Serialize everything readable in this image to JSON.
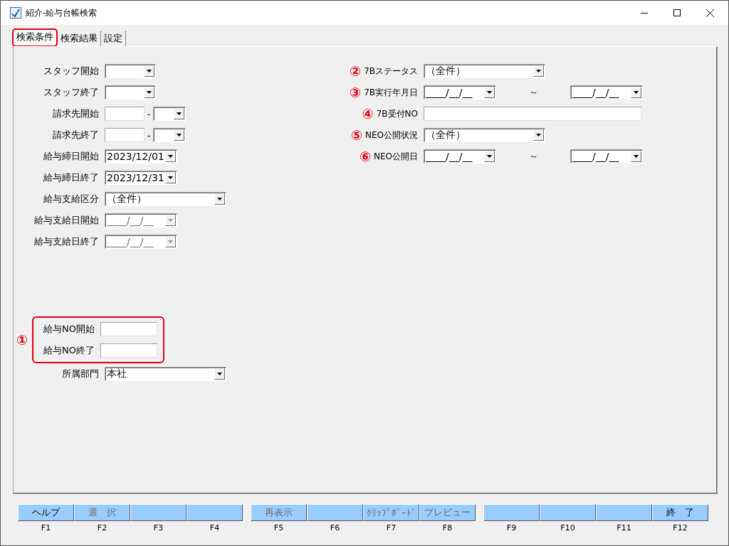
{
  "window": {
    "title": "紹介-給与台帳検索"
  },
  "tabs": [
    {
      "label": "検索条件",
      "selected": true,
      "highlighted": true
    },
    {
      "label": "検索結果",
      "selected": false,
      "highlighted": false
    },
    {
      "label": "設定",
      "selected": false,
      "highlighted": false
    }
  ],
  "left_fields": [
    {
      "label": "スタッフ開始",
      "kind": "picker",
      "disabled": false
    },
    {
      "label": "スタッフ終了",
      "kind": "picker",
      "disabled": false
    },
    {
      "label": "請求先開始",
      "kind": "split",
      "separator": "-"
    },
    {
      "label": "請求先終了",
      "kind": "split",
      "separator": "-"
    },
    {
      "label": "給与締日開始",
      "kind": "date",
      "value": "2023/12/01",
      "disabled": false
    },
    {
      "label": "給与締日終了",
      "kind": "date",
      "value": "2023/12/31",
      "disabled": false
    },
    {
      "label": "給与支給区分",
      "kind": "select",
      "value": "（全件）",
      "disabled": false
    },
    {
      "label": "給与支給日開始",
      "kind": "date",
      "value": "____/__/__",
      "disabled": true
    },
    {
      "label": "給与支給日終了",
      "kind": "date",
      "value": "____/__/__",
      "disabled": true
    }
  ],
  "number_range": {
    "marker": "①",
    "highlighted": true,
    "fields": [
      {
        "label": "給与NO開始",
        "kind": "text"
      },
      {
        "label": "給与NO終了",
        "kind": "text"
      }
    ]
  },
  "department": {
    "label": "所属部門",
    "kind": "select",
    "value": "本社",
    "disabled": false
  },
  "right_fields": [
    {
      "marker": "②",
      "label": "7Bステータス",
      "kind": "combo",
      "value": "（全件）"
    },
    {
      "marker": "③",
      "label": "7B実行年月日",
      "kind": "range",
      "from": "____/__/__",
      "separator": "～",
      "to": "____/__/__"
    },
    {
      "marker": "④",
      "label": "7B受付NO",
      "kind": "text"
    },
    {
      "marker": "⑤",
      "label": "NEO公開状況",
      "kind": "combo",
      "value": "（全件）"
    },
    {
      "marker": "⑥",
      "label": "NEO公開日",
      "kind": "range",
      "from": "____/__/__",
      "separator": "～",
      "to": "____/__/__"
    }
  ],
  "function_key_groups": [
    [
      {
        "label": "ヘルプ",
        "key": "F1",
        "disabled": false
      },
      {
        "label": "選　択",
        "key": "F2",
        "disabled": true
      },
      {
        "key": "F3"
      },
      {
        "key": "F4"
      }
    ],
    [
      {
        "label": "再表示",
        "key": "F5",
        "disabled": true
      },
      {
        "key": "F6"
      },
      {
        "label": "ｸﾘｯﾌﾟﾎﾞｰﾄﾞ",
        "key": "F7",
        "disabled": true
      },
      {
        "label": "プレビュー",
        "key": "F8",
        "disabled": true
      }
    ],
    [
      {
        "key": "F9"
      },
      {
        "key": "F10"
      },
      {
        "key": "F11"
      },
      {
        "label": "終　了",
        "key": "F12",
        "disabled": false
      }
    ]
  ]
}
